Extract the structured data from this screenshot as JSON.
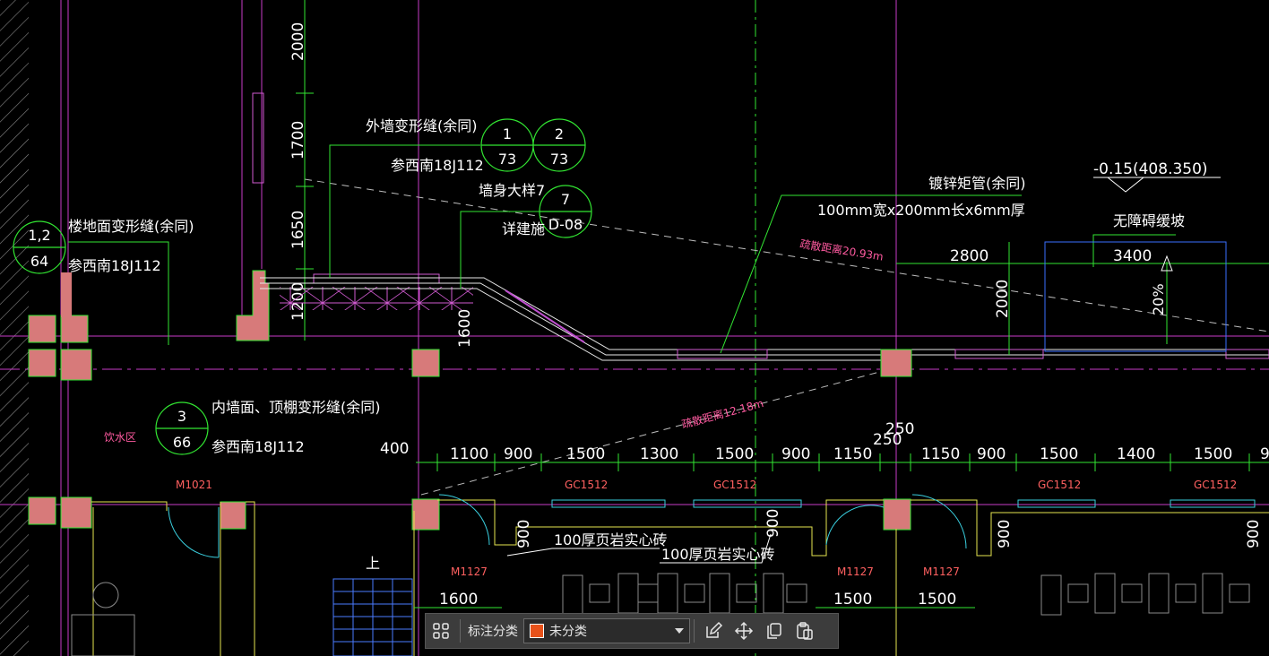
{
  "drawing": {
    "dimensions_vertical": [
      "2000",
      "1700",
      "1650",
      "1200",
      "1600",
      "2000"
    ],
    "dimensions_top_row": [
      "2800",
      "3400"
    ],
    "elevation": "-0.15(408.350)",
    "slope_label": "无障碍缓坡",
    "slope_percent": "20%",
    "pipe_note_1": "镀锌矩管(余同)",
    "pipe_note_2": "100mm宽x200mm长x6mm厚",
    "exterior_joint_text": "外墙变形缝(余同)",
    "exterior_joint_ref": "参西南18J112",
    "exterior_circle_1_top": "1",
    "exterior_circle_1_bottom": "73",
    "exterior_circle_2_top": "2",
    "exterior_circle_2_bottom": "73",
    "wall_detail_text": "墙身大样7",
    "wall_detail_sub": "详建施",
    "wall_circle_top": "7",
    "wall_circle_bottom": "D-08",
    "floor_joint_text": "楼地面变形缝(余同)",
    "floor_joint_ref": "参西南18J112",
    "floor_circle_top": "1,2",
    "floor_circle_bottom": "64",
    "interior_joint_text": "内墙面、顶棚变形缝(余同)",
    "interior_joint_ref": "参西南18J112",
    "interior_circle_top": "3",
    "interior_circle_bottom": "66",
    "distance_1": "疏散距离20.93m",
    "distance_2": "疏散距离12.18m",
    "room_label": "饮水区",
    "dim_400": "400",
    "dims_250": [
      "250",
      "250"
    ],
    "dims_row": [
      "1100",
      "900",
      "1500",
      "1300",
      "1500",
      "900",
      "1150",
      "1150",
      "900",
      "1500",
      "1400",
      "1500",
      "9"
    ],
    "windows": [
      "GC1512",
      "GC1512",
      "GC1512",
      "GC1512"
    ],
    "door_m1021": "M1021",
    "doors_m1127": [
      "M1127",
      "M1127",
      "M1127"
    ],
    "wall_note_1": "100厚页岩实心砖",
    "wall_note_2": "100厚页岩实心砖",
    "small_dims_900": [
      "900",
      "900",
      "900",
      "900"
    ],
    "bottom_dims": [
      "1600",
      "1500",
      "1500"
    ],
    "stair_up": "上"
  },
  "toolbar": {
    "category_label": "标注分类",
    "category_value": "未分类",
    "category_color": "#e8521a"
  },
  "colors": {
    "background": "#000000",
    "grid_magenta": "#c83cc8",
    "green": "#32e632",
    "column_fill": "#d77a7a",
    "wall_yellow": "#e6e650",
    "accent_blue": "#3a70ff"
  }
}
